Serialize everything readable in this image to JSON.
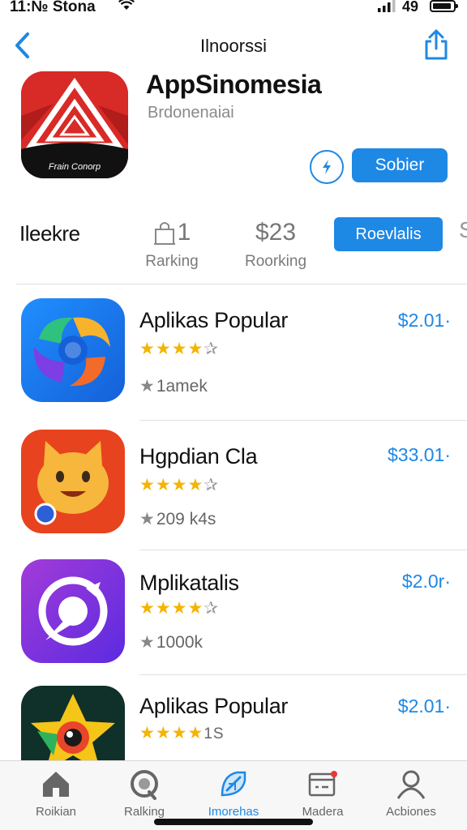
{
  "status_bar": {
    "time": "11:№ Stona",
    "battery_text": "49"
  },
  "nav": {
    "title": "Ilnoorssi"
  },
  "app": {
    "name": "AppSinomesia",
    "subtitle": "Brdonenaiai",
    "icon_caption": "Frain Conorp",
    "get_button": "Sobier"
  },
  "stats": {
    "title": "Ileekre",
    "items": [
      {
        "value": "1",
        "label": "Rarking"
      },
      {
        "value": "$23",
        "label": "Roorking"
      }
    ],
    "button": "Roevlalis",
    "edge_text": "S"
  },
  "list": [
    {
      "name": "Aplikas Popular",
      "stars": "★★★★",
      "half": "✰",
      "count": "1amek",
      "price": "$2.01·"
    },
    {
      "name": "Hgpdian Cla",
      "stars": "★★★★",
      "half": "✰",
      "count": "209 k4s",
      "price": "$33.01·"
    },
    {
      "name": "Mplikatalis",
      "stars": "★★★★",
      "half": "✰",
      "count": "1000k",
      "price": "$2.0r·"
    },
    {
      "name": "Aplikas Popular",
      "stars": "★★★★",
      "half": "1S",
      "count": "",
      "price": "$2.01·"
    }
  ],
  "tabs": [
    {
      "label": "Roikian",
      "icon": "home-icon"
    },
    {
      "label": "Ralking",
      "icon": "ranking-icon"
    },
    {
      "label": "Imorehas",
      "icon": "discover-icon"
    },
    {
      "label": "Madera",
      "icon": "inbox-icon"
    },
    {
      "label": "Acbiones",
      "icon": "person-icon"
    }
  ],
  "colors": {
    "accent": "#1e88e5",
    "star": "#f4b400"
  }
}
